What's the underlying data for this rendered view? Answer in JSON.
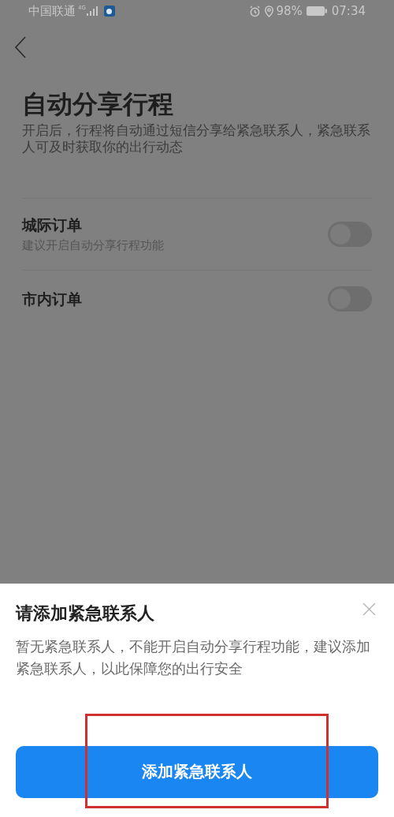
{
  "status_bar": {
    "carrier": "中国联通",
    "network": "4G",
    "battery": "98%",
    "time": "07:34"
  },
  "page": {
    "title": "自动分享行程",
    "description": "开启后，行程将自动通过短信分享给紧急联系人，紧急联系人可及时获取你的出行动态",
    "settings": [
      {
        "label": "城际订单",
        "hint": "建议开启自动分享行程功能",
        "on": false
      },
      {
        "label": "市内订单",
        "on": false
      }
    ]
  },
  "sheet": {
    "title": "请添加紧急联系人",
    "message": "暂无紧急联系人，不能开启自动分享行程功能，建议添加紧急联系人，以此保障您的出行安全",
    "button": "添加紧急联系人"
  },
  "annotation": {
    "kind": "highlight"
  }
}
